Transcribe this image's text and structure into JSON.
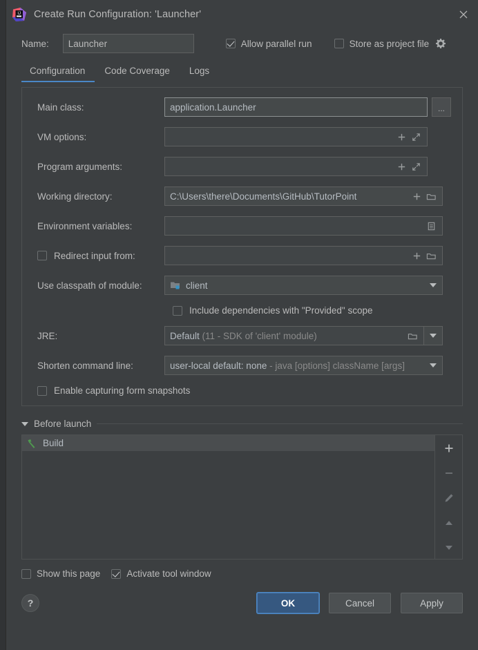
{
  "window": {
    "title": "Create Run Configuration: 'Launcher'",
    "logo_icon": "intellij-idea-logo",
    "close_icon": "close-icon"
  },
  "header": {
    "name_label": "Name:",
    "name_value": "Launcher",
    "name_placeholder": "",
    "allow_parallel_run": {
      "label": "Allow parallel run",
      "checked": true
    },
    "store_as_project_file": {
      "label": "Store as project file",
      "checked": false
    },
    "gear_icon": "gear-icon"
  },
  "tabs": [
    {
      "label": "Configuration",
      "active": true
    },
    {
      "label": "Code Coverage",
      "active": false
    },
    {
      "label": "Logs",
      "active": false
    }
  ],
  "form": {
    "main_class": {
      "label": "Main class:",
      "value": "application.Launcher",
      "browse_label": "...",
      "browse_icon": "ellipsis-browse-icon"
    },
    "vm_options": {
      "label": "VM options:",
      "value": "",
      "icons": [
        "plus-icon",
        "expand-icon"
      ]
    },
    "program_arguments": {
      "label": "Program arguments:",
      "value": "",
      "icons": [
        "plus-icon",
        "expand-icon"
      ]
    },
    "working_directory": {
      "label": "Working directory:",
      "value": "C:\\Users\\there\\Documents\\GitHub\\TutorPoint",
      "icons": [
        "plus-icon",
        "folder-icon"
      ]
    },
    "environment_variables": {
      "label": "Environment variables:",
      "value": "",
      "icons": [
        "list-editor-icon"
      ]
    },
    "redirect_input": {
      "label": "Redirect input from:",
      "checked": false,
      "value": "",
      "icons": [
        "plus-icon",
        "folder-icon"
      ]
    },
    "use_classpath_of_module": {
      "label": "Use classpath of module:",
      "value": "client",
      "module_icon": "module-folder-icon",
      "dropdown_icon": "chevron-down-icon"
    },
    "include_provided_scope": {
      "label": "Include dependencies with \"Provided\" scope",
      "checked": false
    },
    "jre": {
      "label": "JRE:",
      "value": "Default",
      "value_detail": "(11 - SDK of 'client' module)",
      "icons": [
        "folder-icon",
        "chevron-down-icon"
      ]
    },
    "shorten_command_line": {
      "label": "Shorten command line:",
      "value": "user-local default: none",
      "value_detail": "- java [options] className [args]",
      "dropdown_icon": "chevron-down-icon"
    },
    "enable_form_snapshots": {
      "label": "Enable capturing form snapshots",
      "checked": false
    }
  },
  "before_launch": {
    "section_title": "Before launch",
    "collapse_icon": "triangle-down-icon",
    "items": [
      {
        "label": "Build",
        "icon": "hammer-icon",
        "selected": true
      }
    ],
    "toolbar": [
      {
        "name": "add-button",
        "icon": "plus-icon",
        "label": "+"
      },
      {
        "name": "remove-button",
        "icon": "minus-icon",
        "label": "−"
      },
      {
        "name": "edit-button",
        "icon": "pencil-icon",
        "label": ""
      },
      {
        "name": "move-up-button",
        "icon": "triangle-up-icon",
        "label": ""
      },
      {
        "name": "move-down-button",
        "icon": "triangle-down-icon",
        "label": ""
      }
    ]
  },
  "bottom": {
    "show_this_page": {
      "label": "Show this page",
      "checked": false
    },
    "activate_tool_window": {
      "label": "Activate tool window",
      "checked": true
    },
    "help_label": "?",
    "ok_label": "OK",
    "cancel_label": "Cancel",
    "apply_label": "Apply"
  },
  "colors": {
    "dialog_bg": "#3c3f41",
    "field_bg": "#45494a",
    "accent_blue": "#4a88c7",
    "primary_button": "#365880",
    "text": "#bbbbbb",
    "dim_text": "#8a8a8a",
    "build_icon_green": "#4f9c4f"
  }
}
